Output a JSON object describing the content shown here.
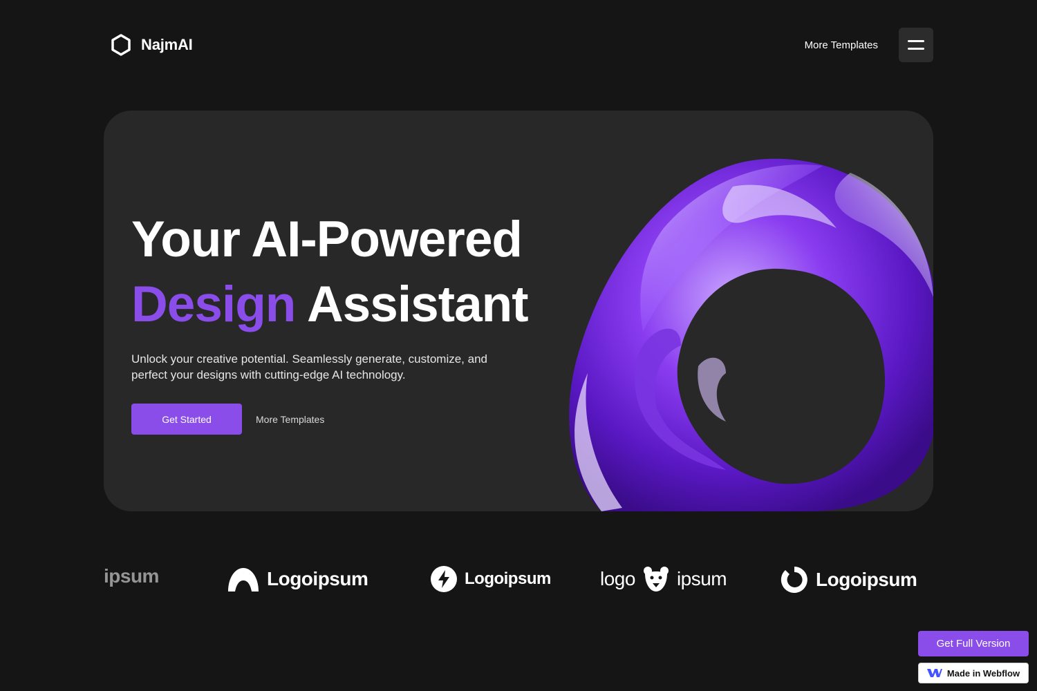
{
  "nav": {
    "brand": "NajmAI",
    "link": "More Templates",
    "menu_icon": "hamburger-icon"
  },
  "hero": {
    "headline_line1": "Your AI-Powered",
    "headline_accent": "Design",
    "headline_rest": " Assistant",
    "subtitle": "Unlock your creative potential. Seamlessly generate, customize, and perfect your designs with cutting-edge AI technology.",
    "primary_cta": "Get Started",
    "secondary_cta": "More Templates",
    "art": "purple-glass-ring"
  },
  "logos": {
    "items": [
      {
        "text": "ipsum",
        "icon": "partial-logo"
      },
      {
        "text": "Logoipsum",
        "icon": "arch-icon"
      },
      {
        "text": "Logoipsum",
        "icon": "bolt-icon"
      },
      {
        "text_left": "logo",
        "text_right": "ipsum",
        "icon": "bear-icon"
      },
      {
        "text": "Logoipsum",
        "icon": "ring-icon"
      }
    ]
  },
  "badges": {
    "full_version": "Get Full Version",
    "webflow": "Made in Webflow"
  },
  "colors": {
    "background": "#151515",
    "card": "#282828",
    "accent": "#8b4dea",
    "text": "#ffffff"
  }
}
